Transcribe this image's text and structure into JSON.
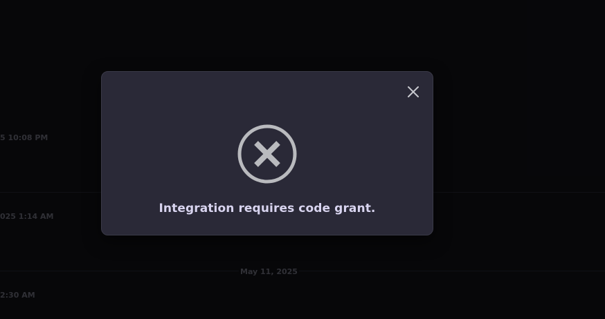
{
  "background": {
    "timestamps": [
      "5 10:08 PM",
      "025 1:14 AM",
      "2:30 AM"
    ],
    "date_separator": "May 11, 2025",
    "partial_date": "..."
  },
  "modal": {
    "message": "Integration requires code grant.",
    "close_icon": "close-icon",
    "status_icon": "error-x-circle-icon"
  },
  "colors": {
    "modal_bg": "#2a2937",
    "message_text": "#d8d4ef",
    "icon_gray": "#b9babe"
  }
}
